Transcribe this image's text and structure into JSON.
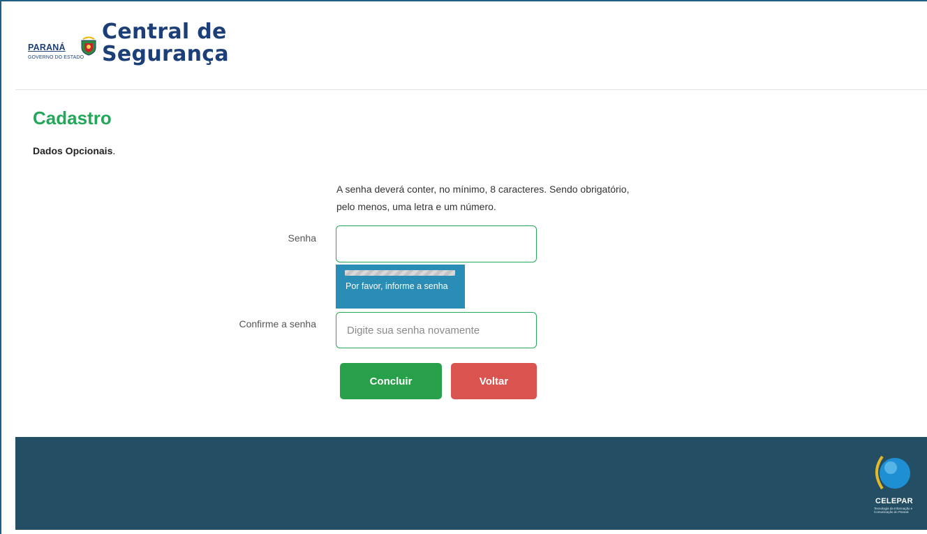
{
  "header": {
    "state_name": "PARANÁ",
    "state_subtitle": "GOVERNO DO ESTADO",
    "app_title_line1": "Central de",
    "app_title_line2": "Segurança"
  },
  "main": {
    "title": "Cadastro",
    "subtitle": "Dados Opcionais",
    "subtitle_suffix": ".",
    "password_hint": "A senha deverá conter, no mínimo, 8 caracteres. Sendo obrigatório, pelo menos, uma letra e um número."
  },
  "form": {
    "password": {
      "label": "Senha",
      "value": "",
      "placeholder": ""
    },
    "password_strength": {
      "level": 0,
      "message": "Por favor, informe a senha"
    },
    "confirm": {
      "label": "Confirme a senha",
      "value": "",
      "placeholder": "Digite sua senha novamente"
    },
    "buttons": {
      "submit": "Concluir",
      "back": "Voltar"
    }
  },
  "footer": {
    "brand_name": "CELEPAR",
    "brand_subtitle": "Tecnologia da Informação e Comunicação do Paraná"
  },
  "colors": {
    "accent_green": "#25a75a",
    "brand_blue": "#1d3f77",
    "footer_bg": "#234e64",
    "strength_bg": "#2a8db5",
    "danger": "#d9534f"
  }
}
